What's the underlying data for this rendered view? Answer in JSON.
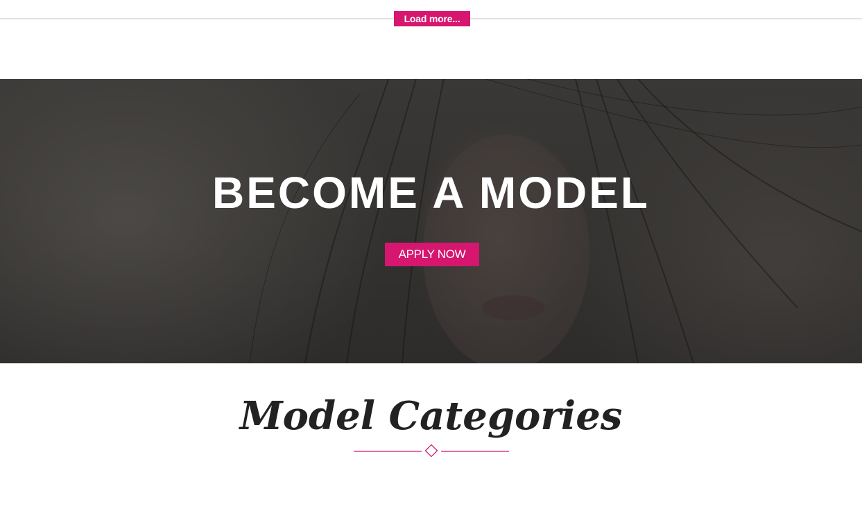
{
  "top": {
    "load_more_label": "Load more..."
  },
  "hero": {
    "title": "BECOME A MODEL",
    "apply_label": "APPLY NOW"
  },
  "categories": {
    "title": "Model Categories"
  },
  "colors": {
    "accent": "#d6166f",
    "hero_overlay": "#343230",
    "title_text": "#222222"
  },
  "icons": {
    "divider": "diamond-divider-icon"
  }
}
